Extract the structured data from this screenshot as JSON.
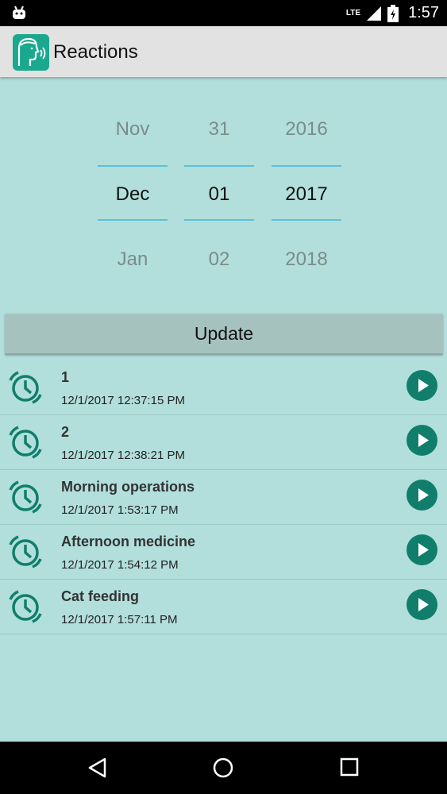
{
  "status_bar": {
    "network": "LTE",
    "time": "1:57"
  },
  "app_bar": {
    "title": "Reactions"
  },
  "date_picker": {
    "month": {
      "prev": "Nov",
      "current": "Dec",
      "next": "Jan"
    },
    "day": {
      "prev": "31",
      "current": "01",
      "next": "02"
    },
    "year": {
      "prev": "2016",
      "current": "2017",
      "next": "2018"
    }
  },
  "update_button": {
    "label": "Update"
  },
  "reactions": [
    {
      "name": "1",
      "timestamp": "12/1/2017 12:37:15 PM"
    },
    {
      "name": "2",
      "timestamp": "12/1/2017 12:38:21 PM"
    },
    {
      "name": "Morning operations",
      "timestamp": "12/1/2017 1:53:17 PM"
    },
    {
      "name": "Afternoon medicine",
      "timestamp": "12/1/2017 1:54:12 PM"
    },
    {
      "name": "Cat feeding",
      "timestamp": "12/1/2017 1:57:11 PM"
    }
  ],
  "colors": {
    "background": "#b2dfdb",
    "accent": "#117e6c",
    "picker_divider": "#5bc0de"
  }
}
